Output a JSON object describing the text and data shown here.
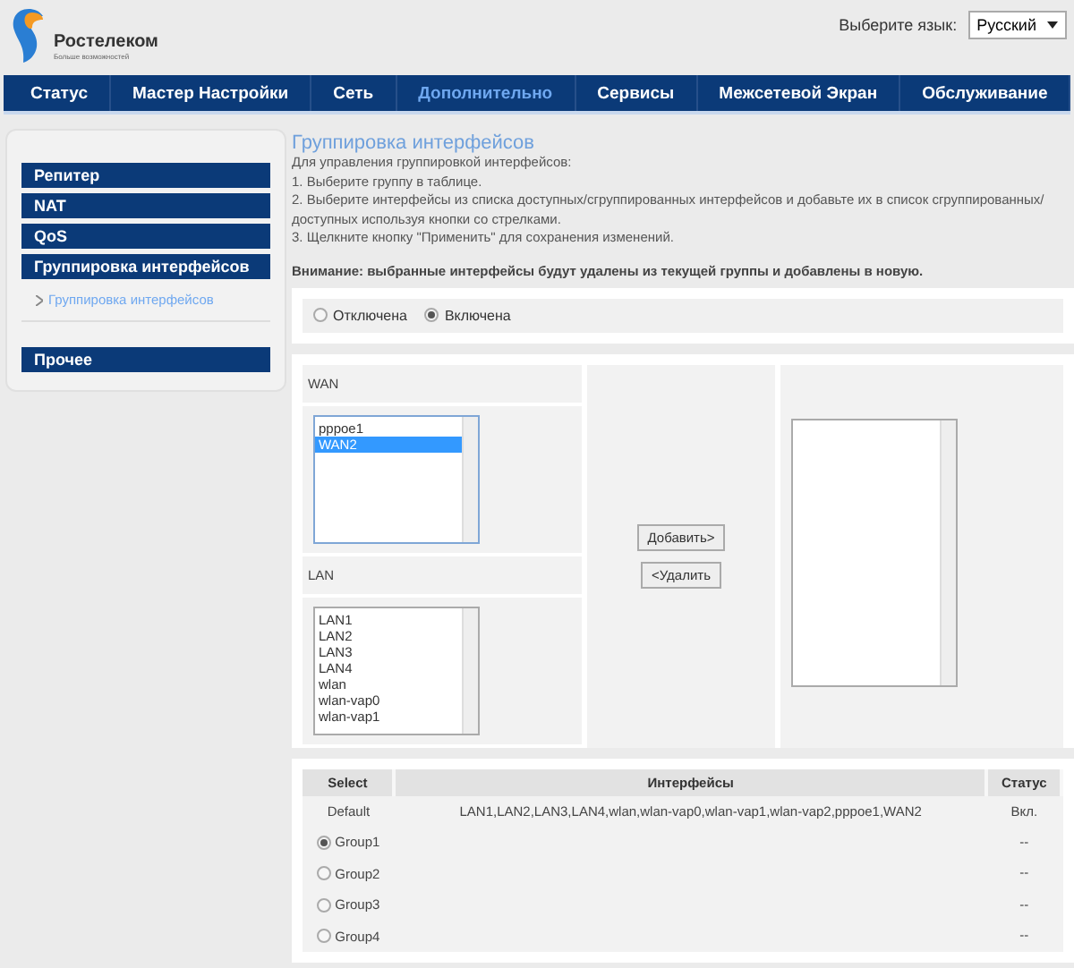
{
  "logo": {
    "name": "Ростелеком",
    "tagline": "Больше возможностей"
  },
  "language": {
    "label": "Выберите язык:",
    "value": "Русский"
  },
  "nav": [
    {
      "label": "Статус",
      "selected": false
    },
    {
      "label": "Мастер Настройки",
      "selected": false
    },
    {
      "label": "Сеть",
      "selected": false
    },
    {
      "label": "Дополнительно",
      "selected": true
    },
    {
      "label": "Сервисы",
      "selected": false
    },
    {
      "label": "Межсетевой Экран",
      "selected": false
    },
    {
      "label": "Обслуживание",
      "selected": false
    }
  ],
  "sidebar": {
    "groups": [
      {
        "items": [
          {
            "label": "Репитер"
          },
          {
            "label": "NAT"
          },
          {
            "label": "QoS"
          },
          {
            "label": "Группировка интерфейсов",
            "children": [
              {
                "label": "Группировка интерфейсов",
                "selected": true
              }
            ]
          }
        ]
      },
      {
        "items": [
          {
            "label": "Прочее"
          }
        ]
      }
    ]
  },
  "title": "Группировка интерфейсов",
  "instructions": [
    "Для управления группировкой интерфейсов:",
    "1. Выберите группу в таблице.",
    "2. Выберите интерфейсы из списка доступных/сгруппированных интерфейсов и добавьте их в список сгруппированных/ доступных используя кнопки со стрелками.",
    "3. Щелкните кнопку \"Применить\" для сохранения изменений."
  ],
  "warning": "Внимание: выбранные интерфейсы будут удалены из текущей группы и добавлены в новую.",
  "mode": [
    {
      "label": "Отключена",
      "selected": false
    },
    {
      "label": "Включена",
      "selected": true
    }
  ],
  "lists": {
    "wan": {
      "label": "WAN",
      "items": [
        {
          "label": "pppoe1",
          "selected": false
        },
        {
          "label": "WAN2",
          "selected": true
        }
      ]
    },
    "lan": {
      "label": "LAN",
      "items": [
        {
          "label": "LAN1",
          "selected": false
        },
        {
          "label": "LAN2",
          "selected": false
        },
        {
          "label": "LAN3",
          "selected": false
        },
        {
          "label": "LAN4",
          "selected": false
        },
        {
          "label": "wlan",
          "selected": false
        },
        {
          "label": "wlan-vap0",
          "selected": false
        },
        {
          "label": "wlan-vap1",
          "selected": false
        }
      ]
    },
    "buttons": [
      "Добавить>",
      "<Удалить"
    ]
  },
  "table": {
    "columns": [
      "Select",
      "Интерфейсы",
      "Статус"
    ],
    "rows": [
      {
        "kind": "label",
        "group": "Default",
        "interfaces": "LAN1,LAN2,LAN3,LAN4,wlan,wlan-vap0,wlan-vap1,wlan-vap2,pppoe1,WAN2",
        "status": "Вкл."
      },
      {
        "kind": "radio",
        "group": "Group1",
        "selected": true,
        "status": "--"
      },
      {
        "kind": "radio",
        "group": "Group2",
        "selected": false,
        "status": "--"
      },
      {
        "kind": "radio",
        "group": "Group3",
        "selected": false,
        "status": "--"
      },
      {
        "kind": "radio",
        "group": "Group4",
        "selected": false,
        "status": "--"
      }
    ]
  }
}
